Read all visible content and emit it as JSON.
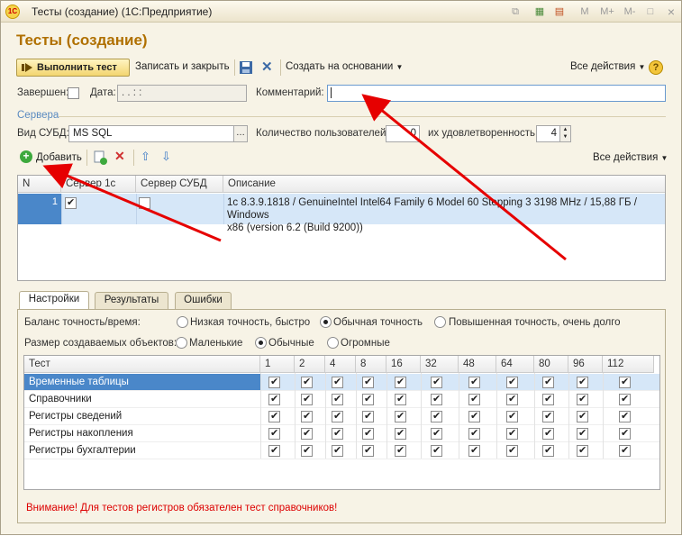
{
  "window": {
    "title": "Тесты (создание)  (1С:Предприятие)",
    "logo_text": "1С",
    "titlebar_icons": [
      "M",
      "M+",
      "M-",
      "□",
      "×"
    ]
  },
  "form": {
    "title": "Тесты (создание)"
  },
  "toolbar": {
    "run_test": "Выполнить тест",
    "save_close": "Записать и закрыть",
    "create_based": "Создать на основании",
    "all_actions": "Все действия",
    "help": "?"
  },
  "fields": {
    "completed_label": "Завершен:",
    "date_label": "Дата:",
    "date_value": "  .  .        :  :",
    "comment_label": "Комментарий:",
    "comment_value": ""
  },
  "servers": {
    "group_title": "Сервера",
    "dbms_label": "Вид СУБД:",
    "dbms_value": "MS SQL",
    "users_label": "Количество пользователей:",
    "users_value": "0",
    "satisfaction_label": "их удовлетворенность:",
    "satisfaction_value": "4",
    "add_button": "Добавить",
    "all_actions": "Все действия",
    "columns": [
      "N",
      "Сервер 1с",
      "Сервер СУБД",
      "Описание"
    ],
    "rows": [
      {
        "n": "1",
        "server_1c": true,
        "server_dbms": false,
        "description_line1": "1c 8.3.9.1818 / GenuineIntel Intel64 Family 6 Model 60 Stepping 3 3198 MHz / 15,88 ГБ / Windows",
        "description_line2": "x86 (version 6.2  (Build 9200))"
      }
    ]
  },
  "tabs": [
    "Настройки",
    "Результаты",
    "Ошибки"
  ],
  "settings": {
    "balance_label": "Баланс точность/время:",
    "balance_options": [
      "Низкая точность, быстро",
      "Обычная точность",
      "Повышенная точность, очень долго"
    ],
    "balance_selected": 1,
    "size_label": "Размер создаваемых объектов:",
    "size_options": [
      "Маленькие",
      "Обычные",
      "Огромные"
    ],
    "size_selected": 1
  },
  "test_grid": {
    "columns": [
      "Тест",
      "1",
      "2",
      "4",
      "8",
      "16",
      "32",
      "48",
      "64",
      "80",
      "96",
      "112"
    ],
    "rows": [
      {
        "name": "Временные таблицы",
        "selected": true
      },
      {
        "name": "Справочники",
        "selected": false
      },
      {
        "name": "Регистры сведений",
        "selected": false
      },
      {
        "name": "Регистры накопления",
        "selected": false
      },
      {
        "name": "Регистры бухгалтерии",
        "selected": false
      }
    ]
  },
  "warning": "Внимание! Для тестов регистров обязателен тест справочников!",
  "colors": {
    "title": "#b07000",
    "selection": "#4a87c9",
    "arrow": "#e60000",
    "warning": "#dd0000"
  }
}
